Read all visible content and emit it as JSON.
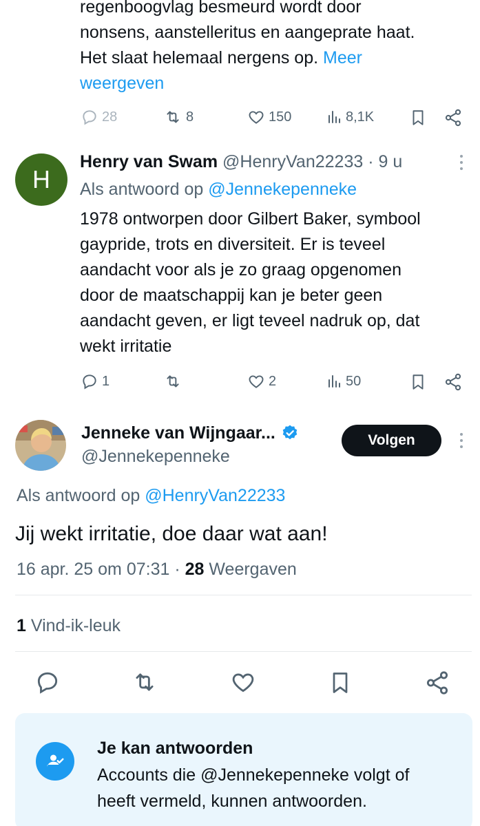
{
  "prev_tweet": {
    "lines": [
      "regenboogvlag besmeurd wordt door",
      "nonsens, aanstelleritus en aangeprate haat.",
      "Het slaat helemaal nergens op."
    ],
    "more_link_1": "Meer",
    "more_link_2": "weergeven",
    "actions": {
      "replies": "28",
      "retweets": "8",
      "likes": "150",
      "views": "8,1K"
    }
  },
  "reply_tweet": {
    "avatar_letter": "H",
    "avatar_color": "#3c6b1d",
    "name": "Henry van Swam",
    "handle": "@HenryVan22233",
    "separator": "·",
    "time": "9 u",
    "reply_to_prefix": "Als antwoord op",
    "reply_to_handle": "@Jennekepenneke",
    "lines": [
      "1978 ontworpen door Gilbert Baker, symbool",
      "gaypride, trots en diversiteit. Er is teveel",
      "aandacht voor als je zo graag opgenomen",
      "door de maatschappij kan je beter geen",
      "aandacht geven, er ligt teveel nadruk op, dat",
      "wekt irritatie"
    ],
    "actions": {
      "replies": "1",
      "retweets": "",
      "likes": "2",
      "views": "50"
    }
  },
  "main_tweet": {
    "name": "Jenneke van Wijngaar...",
    "handle": "@Jennekepenneke",
    "verified_color": "#1d9bf0",
    "follow_label": "Volgen",
    "reply_to_prefix": "Als antwoord op",
    "reply_to_handle": "@HenryVan22233",
    "text": "Jij wekt irritatie, doe daar wat aan!",
    "timestamp": "16 apr. 25 om 07:31",
    "separator": "·",
    "view_count": "28",
    "views_label": "Weergaven",
    "like_count": "1",
    "likes_label": "Vind-ik-leuk"
  },
  "notice": {
    "title": "Je kan antwoorden",
    "line1": "Accounts die @Jennekepenneke volgt of",
    "line2": "heeft vermeld, kunnen antwoorden.",
    "icon_color": "#1d9bf0"
  },
  "icons": {
    "reply": "reply-icon",
    "retweet": "retweet-icon",
    "like": "heart-icon",
    "views": "views-icon",
    "bookmark": "bookmark-icon",
    "share": "share-icon",
    "more": "more-icon",
    "verified": "verified-badge-icon",
    "notice": "person-check-icon"
  }
}
